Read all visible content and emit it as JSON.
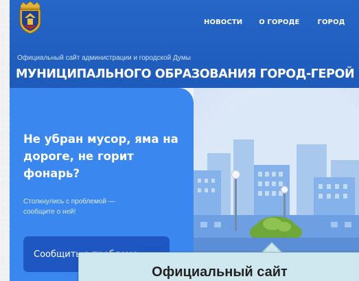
{
  "header": {
    "logo_icon": "city-coat-of-arms-icon",
    "nav": [
      {
        "label": "НОВОСТИ"
      },
      {
        "label": "О ГОРОДЕ"
      },
      {
        "label": "ГОРОД"
      }
    ],
    "subtitle": "Официальный сайт администрации и городской Думы",
    "title": "МУНИЦИПАЛЬНОГО ОБРАЗОВАНИЯ ГОРОД-ГЕРОЙ"
  },
  "hero": {
    "heading": "Не убран мусор, яма на дороге, не горит фонарь?",
    "text": "Столкнулись с проблемой — сообщите о ней!",
    "button_label": "Сообщить о проблеме",
    "illustration_icon": "city-skyline-illustration"
  },
  "tooltip": {
    "text": "Официальный сайт"
  },
  "colors": {
    "header_blue": "#2566c6",
    "card_blue": "#3a87f0",
    "button_blue": "#1e57c2",
    "tooltip_bg": "#cfe7ef"
  }
}
